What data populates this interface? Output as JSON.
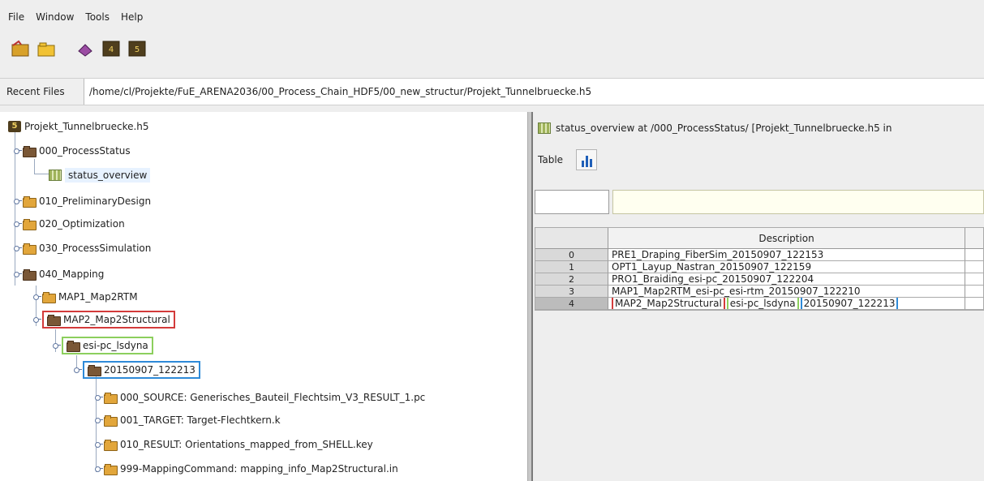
{
  "menu": {
    "items": [
      "File",
      "Window",
      "Tools",
      "Help"
    ]
  },
  "toolbar": {
    "buttons": [
      "open-file-icon",
      "open-folder-icon",
      "book-icon",
      "hdf4-icon",
      "hdf5-icon"
    ]
  },
  "recent": {
    "label": "Recent Files",
    "path": "/home/cl/Projekte/FuE_ARENA2036/00_Process_Chain_HDF5/00_new_structur/Projekt_Tunnelbruecke.h5"
  },
  "tree": {
    "root": "Projekt_Tunnelbruecke.h5",
    "items": [
      "000_ProcessStatus",
      "status_overview",
      "010_PreliminaryDesign",
      "020_Optimization",
      "030_ProcessSimulation",
      "040_Mapping",
      "MAP1_Map2RTM",
      "MAP2_Map2Structural",
      "esi-pc_lsdyna",
      "20150907_122213",
      "000_SOURCE: Generisches_Bauteil_Flechtsim_V3_RESULT_1.pc",
      "001_TARGET: Target-Flechtkern.k",
      "010_RESULT: Orientations_mapped_from_SHELL.key",
      "999-MappingCommand: mapping_info_Map2Structural.in"
    ]
  },
  "rightpane": {
    "title": "status_overview  at  /000_ProcessStatus/  [Projekt_Tunnelbruecke.h5  in",
    "menu_table": "Table",
    "table": {
      "header": "Description",
      "rows": [
        {
          "index": "0",
          "value": "PRE1_Draping_FiberSim_20150907_122153"
        },
        {
          "index": "1",
          "value": "OPT1_Layup_Nastran_20150907_122159"
        },
        {
          "index": "2",
          "value": "PRO1_Braiding_esi-pc_20150907_122204"
        },
        {
          "index": "3",
          "value": "MAP1_Map2RTM_esi-pc_esi-rtm_20150907_122210"
        },
        {
          "index": "4",
          "parts": [
            "MAP2_Map2Structural",
            "esi-pc_lsdyna",
            "20150907_122213"
          ]
        }
      ]
    }
  },
  "colors": {
    "red_highlight": "#d33b3b",
    "green_highlight": "#8ccf5d",
    "blue_highlight": "#2e8ad8"
  }
}
